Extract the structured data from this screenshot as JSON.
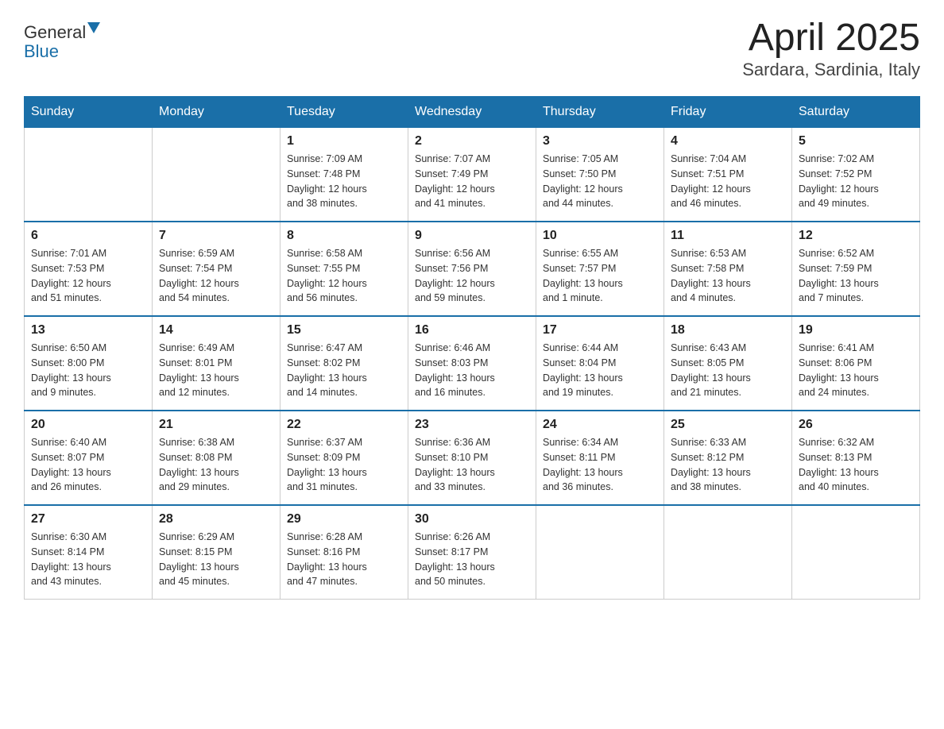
{
  "header": {
    "logo_text_black": "General",
    "logo_text_blue": "Blue",
    "month_title": "April 2025",
    "location": "Sardara, Sardinia, Italy"
  },
  "days_of_week": [
    "Sunday",
    "Monday",
    "Tuesday",
    "Wednesday",
    "Thursday",
    "Friday",
    "Saturday"
  ],
  "weeks": [
    [
      {
        "day": "",
        "info": ""
      },
      {
        "day": "",
        "info": ""
      },
      {
        "day": "1",
        "info": "Sunrise: 7:09 AM\nSunset: 7:48 PM\nDaylight: 12 hours\nand 38 minutes."
      },
      {
        "day": "2",
        "info": "Sunrise: 7:07 AM\nSunset: 7:49 PM\nDaylight: 12 hours\nand 41 minutes."
      },
      {
        "day": "3",
        "info": "Sunrise: 7:05 AM\nSunset: 7:50 PM\nDaylight: 12 hours\nand 44 minutes."
      },
      {
        "day": "4",
        "info": "Sunrise: 7:04 AM\nSunset: 7:51 PM\nDaylight: 12 hours\nand 46 minutes."
      },
      {
        "day": "5",
        "info": "Sunrise: 7:02 AM\nSunset: 7:52 PM\nDaylight: 12 hours\nand 49 minutes."
      }
    ],
    [
      {
        "day": "6",
        "info": "Sunrise: 7:01 AM\nSunset: 7:53 PM\nDaylight: 12 hours\nand 51 minutes."
      },
      {
        "day": "7",
        "info": "Sunrise: 6:59 AM\nSunset: 7:54 PM\nDaylight: 12 hours\nand 54 minutes."
      },
      {
        "day": "8",
        "info": "Sunrise: 6:58 AM\nSunset: 7:55 PM\nDaylight: 12 hours\nand 56 minutes."
      },
      {
        "day": "9",
        "info": "Sunrise: 6:56 AM\nSunset: 7:56 PM\nDaylight: 12 hours\nand 59 minutes."
      },
      {
        "day": "10",
        "info": "Sunrise: 6:55 AM\nSunset: 7:57 PM\nDaylight: 13 hours\nand 1 minute."
      },
      {
        "day": "11",
        "info": "Sunrise: 6:53 AM\nSunset: 7:58 PM\nDaylight: 13 hours\nand 4 minutes."
      },
      {
        "day": "12",
        "info": "Sunrise: 6:52 AM\nSunset: 7:59 PM\nDaylight: 13 hours\nand 7 minutes."
      }
    ],
    [
      {
        "day": "13",
        "info": "Sunrise: 6:50 AM\nSunset: 8:00 PM\nDaylight: 13 hours\nand 9 minutes."
      },
      {
        "day": "14",
        "info": "Sunrise: 6:49 AM\nSunset: 8:01 PM\nDaylight: 13 hours\nand 12 minutes."
      },
      {
        "day": "15",
        "info": "Sunrise: 6:47 AM\nSunset: 8:02 PM\nDaylight: 13 hours\nand 14 minutes."
      },
      {
        "day": "16",
        "info": "Sunrise: 6:46 AM\nSunset: 8:03 PM\nDaylight: 13 hours\nand 16 minutes."
      },
      {
        "day": "17",
        "info": "Sunrise: 6:44 AM\nSunset: 8:04 PM\nDaylight: 13 hours\nand 19 minutes."
      },
      {
        "day": "18",
        "info": "Sunrise: 6:43 AM\nSunset: 8:05 PM\nDaylight: 13 hours\nand 21 minutes."
      },
      {
        "day": "19",
        "info": "Sunrise: 6:41 AM\nSunset: 8:06 PM\nDaylight: 13 hours\nand 24 minutes."
      }
    ],
    [
      {
        "day": "20",
        "info": "Sunrise: 6:40 AM\nSunset: 8:07 PM\nDaylight: 13 hours\nand 26 minutes."
      },
      {
        "day": "21",
        "info": "Sunrise: 6:38 AM\nSunset: 8:08 PM\nDaylight: 13 hours\nand 29 minutes."
      },
      {
        "day": "22",
        "info": "Sunrise: 6:37 AM\nSunset: 8:09 PM\nDaylight: 13 hours\nand 31 minutes."
      },
      {
        "day": "23",
        "info": "Sunrise: 6:36 AM\nSunset: 8:10 PM\nDaylight: 13 hours\nand 33 minutes."
      },
      {
        "day": "24",
        "info": "Sunrise: 6:34 AM\nSunset: 8:11 PM\nDaylight: 13 hours\nand 36 minutes."
      },
      {
        "day": "25",
        "info": "Sunrise: 6:33 AM\nSunset: 8:12 PM\nDaylight: 13 hours\nand 38 minutes."
      },
      {
        "day": "26",
        "info": "Sunrise: 6:32 AM\nSunset: 8:13 PM\nDaylight: 13 hours\nand 40 minutes."
      }
    ],
    [
      {
        "day": "27",
        "info": "Sunrise: 6:30 AM\nSunset: 8:14 PM\nDaylight: 13 hours\nand 43 minutes."
      },
      {
        "day": "28",
        "info": "Sunrise: 6:29 AM\nSunset: 8:15 PM\nDaylight: 13 hours\nand 45 minutes."
      },
      {
        "day": "29",
        "info": "Sunrise: 6:28 AM\nSunset: 8:16 PM\nDaylight: 13 hours\nand 47 minutes."
      },
      {
        "day": "30",
        "info": "Sunrise: 6:26 AM\nSunset: 8:17 PM\nDaylight: 13 hours\nand 50 minutes."
      },
      {
        "day": "",
        "info": ""
      },
      {
        "day": "",
        "info": ""
      },
      {
        "day": "",
        "info": ""
      }
    ]
  ]
}
